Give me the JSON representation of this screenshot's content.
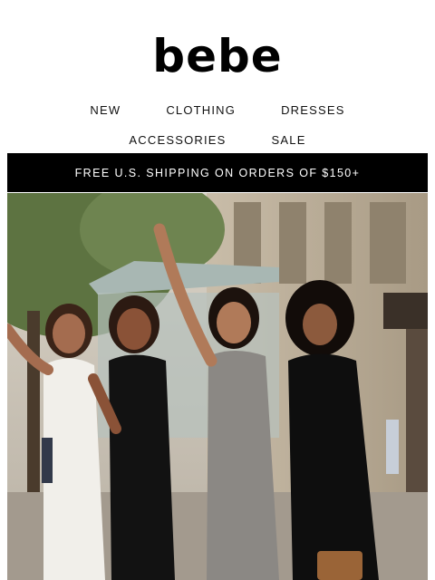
{
  "brand": {
    "logo_text": "bebe"
  },
  "nav": {
    "row1": [
      "NEW",
      "CLOTHING",
      "DRESSES"
    ],
    "row2": [
      "ACCESSORIES",
      "SALE"
    ]
  },
  "banner": {
    "text": "FREE U.S. SHIPPING ON ORDERS OF $150+"
  },
  "hero": {
    "image_label": ""
  },
  "colors": {
    "banner_bg": "#000000",
    "banner_text": "#ffffff",
    "nav_text": "#111111"
  }
}
